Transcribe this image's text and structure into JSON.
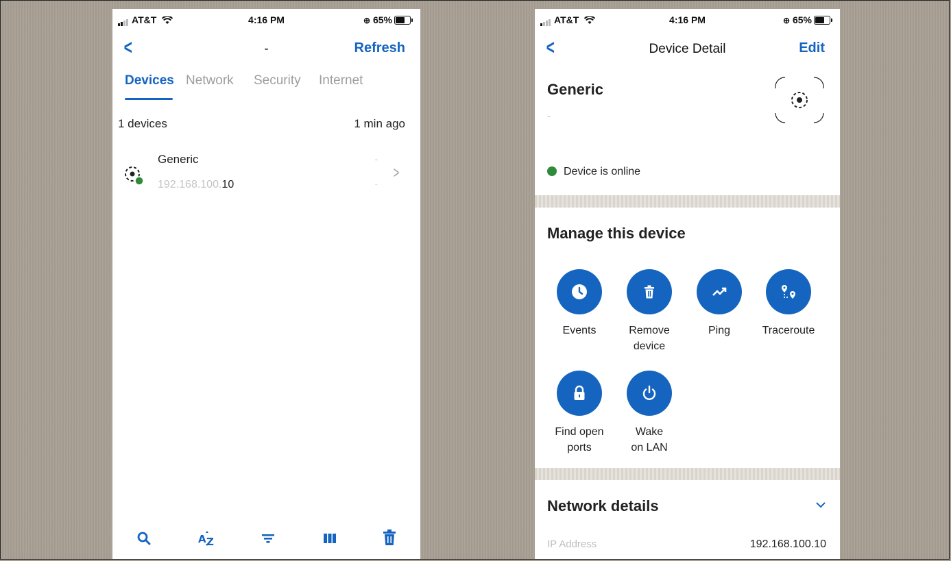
{
  "status": {
    "carrier": "AT&T",
    "time": "4:16 PM",
    "battery": "65%"
  },
  "left": {
    "nav_title": "-",
    "refresh": "Refresh",
    "tabs": [
      "Devices",
      "Network",
      "Security",
      "Internet"
    ],
    "device_count": "1 devices",
    "updated": "1 min ago",
    "device": {
      "name": "Generic",
      "ip_prefix": "192.168.100.",
      "ip_suffix": "10",
      "dash": "-"
    }
  },
  "right": {
    "nav_title": "Device Detail",
    "edit": "Edit",
    "device_name": "Generic",
    "device_sub": "-",
    "online": "Device is online",
    "manage_title": "Manage this device",
    "actions": [
      {
        "label": "Events",
        "icon": "clock-icon"
      },
      {
        "label": "Remove device",
        "icon": "trash-icon"
      },
      {
        "label": "Ping",
        "icon": "trend-icon"
      },
      {
        "label": "Traceroute",
        "icon": "route-icon"
      },
      {
        "label": "Find open ports",
        "icon": "lock-icon"
      },
      {
        "label": "Wake on LAN",
        "icon": "power-icon"
      }
    ],
    "network_title": "Network details",
    "ip_label": "IP Address",
    "ip_value": "192.168.100.10"
  },
  "colors": {
    "accent": "#1565c0",
    "online": "#2e8b3a"
  }
}
